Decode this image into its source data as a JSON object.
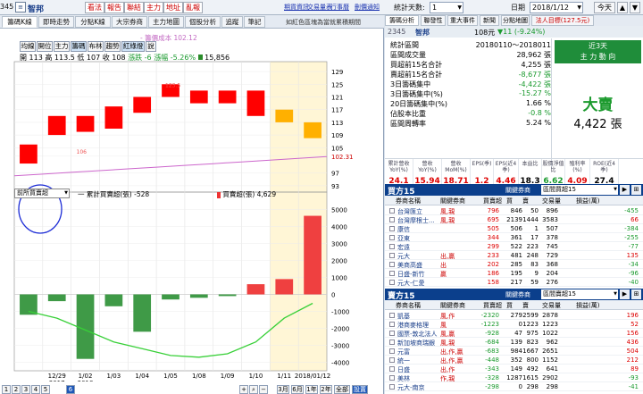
{
  "top": {
    "code": "345",
    "name": "智邦",
    "buttons": [
      "看法",
      "報告",
      "聯結",
      "主力",
      "地址",
      "亂報"
    ],
    "links": [
      "期貨資訊",
      "交易量表",
      "行事曆",
      "刪價通知"
    ],
    "days_label": "統計天數:",
    "days_value": "1",
    "date_label": "日期",
    "date_value": "2018/1/12",
    "prev": "今天",
    "up": "▲",
    "down": "▼"
  },
  "left": {
    "tabs": [
      "籌碼K線",
      "即時走勢",
      "分點K線",
      "大宗券商",
      "主力地圖",
      "個股分析",
      "追蹤",
      "筆記"
    ],
    "note": "如紅色區塊為當就累積期間",
    "tools": [
      "均線",
      "開位",
      "主力",
      "籌碼",
      "布林",
      "趨勢",
      "紅綠燈",
      "說"
    ],
    "cost_label": "- 籌價成本 102.12",
    "ohlc": {
      "open_l": "開",
      "open": "113",
      "high_l": "高",
      "high": "113.5",
      "low_l": "低",
      "low": "107",
      "close_l": "收",
      "close": "108",
      "chg_l": "漲跌",
      "chg": "-6",
      "pct_l": "漲幅",
      "pct": "-5.26%",
      "vol": "15,856"
    },
    "price_axis": [
      "129",
      "125",
      "121",
      "117",
      "113",
      "109",
      "105",
      "102.31",
      "97",
      "93"
    ],
    "label_1235": "123.5",
    "label_106": "106",
    "lower_select": "前所買賣超",
    "lower_legend1": "一 累計買賣超(張) -528",
    "lower_legend2": "買賣超(張) 4,629",
    "lower_axis": [
      "5000",
      "4000",
      "3000",
      "2000",
      "1000",
      "0",
      "-1000",
      "-2000",
      "-3000",
      "-4000"
    ],
    "x_labels": [
      "12/29",
      "1/02",
      "1/03",
      "1/04",
      "1/05",
      "1/08",
      "1/09",
      "1/10",
      "1/11",
      "2018/01/12"
    ],
    "x_years": [
      "2017",
      "2018"
    ],
    "pages": [
      "1",
      "2",
      "3",
      "4",
      "5",
      "6"
    ],
    "zoom": [
      "3月",
      "6月",
      "1年",
      "2年",
      "全部",
      "設置"
    ]
  },
  "chart_data": [
    {
      "type": "candlestick",
      "x": [
        "12/28",
        "12/29",
        "1/02",
        "1/03",
        "1/04",
        "1/05",
        "1/08",
        "1/09",
        "1/10",
        "1/11",
        "1/12"
      ],
      "open": [
        106,
        115,
        110,
        118,
        116,
        125,
        123,
        119,
        123,
        117,
        113
      ],
      "close": [
        100,
        109,
        115,
        111,
        121,
        121,
        119,
        123,
        115,
        113,
        108
      ],
      "high": [
        107,
        116,
        116,
        119,
        122,
        123.5,
        124,
        124,
        124,
        118,
        113.5
      ],
      "low": [
        99,
        107,
        106,
        110,
        115,
        119,
        118,
        118,
        114,
        112,
        107
      ],
      "colors": {
        "up": "#ff0000",
        "down": "#ff0000",
        "highlight": "#ffb000"
      },
      "cost_line": 102.12,
      "last_price": 102.31,
      "ylim": [
        91,
        131
      ]
    },
    {
      "type": "bar",
      "x": [
        "12/28",
        "12/29",
        "1/02",
        "1/03",
        "1/04",
        "1/05",
        "1/08",
        "1/09",
        "1/10",
        "1/11",
        "1/12"
      ],
      "values": [
        -1200,
        -400,
        -3800,
        -700,
        -2200,
        -300,
        -200,
        -100,
        600,
        900,
        4629
      ],
      "series": [
        {
          "name": "累計買賣超(張)",
          "values": [
            -1000,
            -1400,
            -2100,
            -2800,
            -3200,
            -3600,
            -3700,
            -3500,
            -2800,
            -1400,
            -528
          ]
        }
      ],
      "ylim": [
        -4500,
        5500
      ]
    }
  ],
  "right": {
    "tabs": [
      "籌碼分析",
      "聯發性",
      "重大事件",
      "新聞",
      "分點地圖",
      "法人目標(127.5元)"
    ],
    "code": "2345",
    "name": "智邦",
    "price": "108元",
    "change": "▼11 (-9.24%)",
    "stats": [
      {
        "k": "統計區間",
        "v": "20180110～2018011"
      },
      {
        "k": "區間成交量",
        "v": "28,962 張"
      },
      {
        "k": "買超前15名合計",
        "v": "4,255 張"
      },
      {
        "k": "賣超前15名合計",
        "v": "-8,677 張"
      },
      {
        "k": "3日籌碼集中",
        "v": "-4,422 張"
      },
      {
        "k": "3日籌碼集中(%)",
        "v": "-15.27 %"
      },
      {
        "k": "20日籌碼集中(%)",
        "v": "1.66 %"
      },
      {
        "k": "佔股本比重",
        "v": "-0.8 %"
      },
      {
        "k": "區間周轉率",
        "v": "5.24 %"
      }
    ],
    "box_title1": "近3天",
    "box_title2": "主 力 動 向",
    "big": "大賣",
    "big_val": "4,422 張",
    "metrics": [
      {
        "h": "累計營收YoY(%)",
        "v": "24.1",
        "c": "#d00"
      },
      {
        "h": "營收YoY(%)",
        "v": "15.94",
        "c": "#d00"
      },
      {
        "h": "營收MoM(%)",
        "v": "18.71",
        "c": "#d00"
      },
      {
        "h": "EPS(季)",
        "v": "1.2",
        "c": "#d00"
      },
      {
        "h": "EPS(近4季)",
        "v": "4.46",
        "c": "#d00"
      },
      {
        "h": "本益比",
        "v": "18.3",
        "c": "#000"
      },
      {
        "h": "股價淨值比",
        "v": "6.62",
        "c": "#1a9a2e"
      },
      {
        "h": "殖利率(%)",
        "v": "4.09",
        "c": "#d00"
      },
      {
        "h": "ROE(近4季)",
        "v": "27.4",
        "c": "#000"
      }
    ],
    "buy": {
      "title": "買方15",
      "select_label": "關鍵券商",
      "select": "區間買超15",
      "cols": [
        "券商名稱",
        "關鍵券商",
        "買賣超",
        "買",
        "賣",
        "交易量",
        "損益(萬)"
      ],
      "rows": [
        [
          "台灣匯立",
          "風,親",
          "796",
          "846",
          "50",
          "896",
          "-455"
        ],
        [
          "台灣摩根士...",
          "風,親",
          "695",
          "2139",
          "1444",
          "3583",
          "66"
        ],
        [
          "康信",
          "",
          "505",
          "506",
          "1",
          "507",
          "-384"
        ],
        [
          "亞東",
          "",
          "344",
          "361",
          "17",
          "378",
          "-255"
        ],
        [
          "宏遠",
          "",
          "299",
          "522",
          "223",
          "745",
          "-77"
        ],
        [
          "元大",
          "出,贏",
          "233",
          "481",
          "248",
          "729",
          "135"
        ],
        [
          "美商高盛",
          "出",
          "202",
          "285",
          "83",
          "368",
          "-34"
        ],
        [
          "日盛-新竹",
          "贏",
          "186",
          "195",
          "9",
          "204",
          "-96"
        ],
        [
          "元大-仁愛",
          "",
          "158",
          "217",
          "59",
          "276",
          "-40"
        ]
      ]
    },
    "sell": {
      "title": "賣方15",
      "select_label": "關鍵券商",
      "select": "區間賣超15",
      "cols": [
        "券商名稱",
        "關鍵券商",
        "買賣超",
        "買",
        "賣",
        "交易量",
        "損益(萬)"
      ],
      "rows": [
        [
          "凱基",
          "風,作",
          "-2320",
          "279",
          "2599",
          "2878",
          "196"
        ],
        [
          "港商麥格理",
          "風",
          "-1223",
          "0",
          "1223",
          "1223",
          "52"
        ],
        [
          "國票-敦北法人",
          "風,贏",
          "-928",
          "47",
          "975",
          "1022",
          "156"
        ],
        [
          "新加坡商瑞銀",
          "風,親",
          "-684",
          "139",
          "823",
          "962",
          "436"
        ],
        [
          "元富",
          "出,作,贏",
          "-683",
          "984",
          "1667",
          "2651",
          "504"
        ],
        [
          "統一",
          "出,作,贏",
          "-448",
          "352",
          "800",
          "1152",
          "212"
        ],
        [
          "日盛",
          "出,作",
          "-343",
          "149",
          "492",
          "641",
          "89"
        ],
        [
          "美林",
          "作,親",
          "-328",
          "1287",
          "1615",
          "2902",
          "-93"
        ],
        [
          "元大-南京",
          "",
          "-298",
          "0",
          "298",
          "298",
          "-41"
        ]
      ]
    }
  }
}
